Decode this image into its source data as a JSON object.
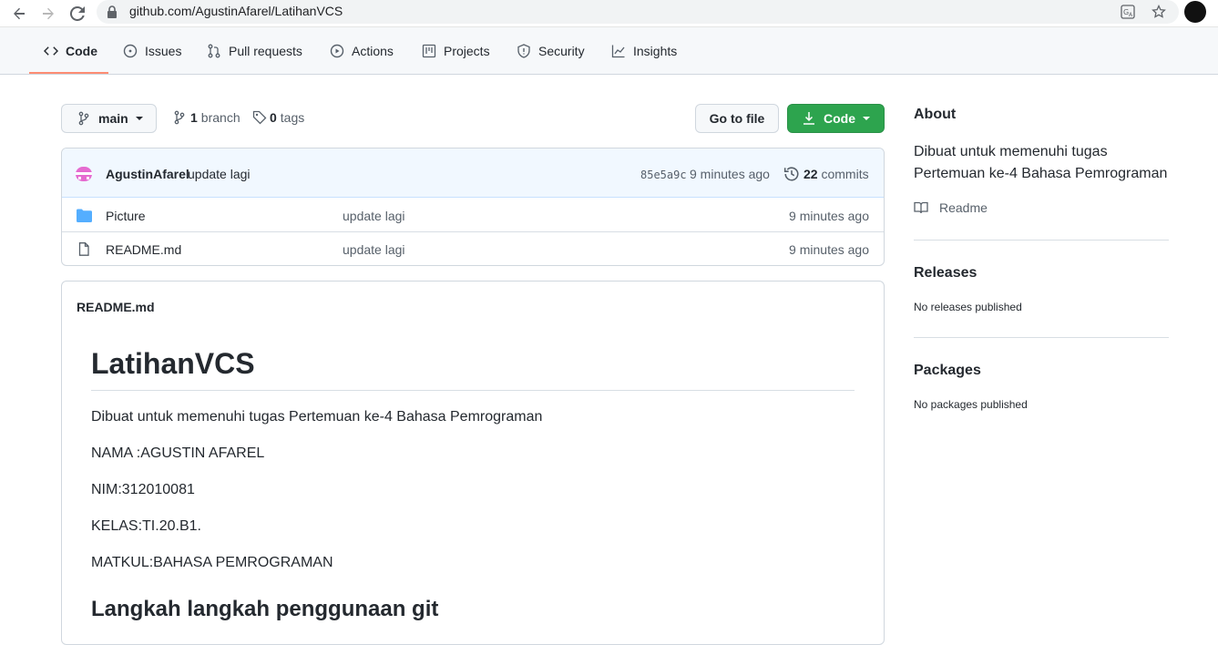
{
  "browser": {
    "url": "github.com/AgustinAfarel/LatihanVCS"
  },
  "repo_nav": {
    "tabs": [
      {
        "label": "Code",
        "icon": "code-icon",
        "selected": true
      },
      {
        "label": "Issues",
        "icon": "issue-icon"
      },
      {
        "label": "Pull requests",
        "icon": "pull-request-icon"
      },
      {
        "label": "Actions",
        "icon": "play-icon"
      },
      {
        "label": "Projects",
        "icon": "project-icon"
      },
      {
        "label": "Security",
        "icon": "shield-icon"
      },
      {
        "label": "Insights",
        "icon": "graph-icon"
      }
    ],
    "accent_color": "#fd8c73"
  },
  "toolbar": {
    "branch_name": "main",
    "branch_count": "1",
    "branch_label": "branch",
    "tag_count": "0",
    "tag_label": "tags",
    "go_to_file": "Go to file",
    "code_button": "Code",
    "code_button_color": "#2da44e"
  },
  "latest_commit": {
    "author": "AgustinAfarel",
    "message": "update lagi",
    "sha": "85e5a9c",
    "time": "9 minutes ago",
    "commit_count": "22",
    "commits_label": "commits"
  },
  "files": [
    {
      "name": "Picture",
      "type": "folder",
      "message": "update lagi",
      "age": "9 minutes ago"
    },
    {
      "name": "README.md",
      "type": "file",
      "message": "update lagi",
      "age": "9 minutes ago"
    }
  ],
  "readme": {
    "header": "README.md",
    "title": "LatihanVCS",
    "paragraphs": [
      "Dibuat untuk memenuhi tugas Pertemuan ke-4 Bahasa Pemrograman",
      "NAMA :AGUSTIN AFAREL",
      "NIM:312010081",
      "KELAS:TI.20.B1.",
      "MATKUL:BAHASA PEMROGRAMAN"
    ],
    "subheading": "Langkah langkah penggunaan git"
  },
  "sidebar": {
    "about_heading": "About",
    "about_description": "Dibuat untuk memenuhi tugas Pertemuan ke-4 Bahasa Pemrograman",
    "readme_link": "Readme",
    "releases_heading": "Releases",
    "releases_text": "No releases published",
    "packages_heading": "Packages",
    "packages_text": "No packages published"
  }
}
